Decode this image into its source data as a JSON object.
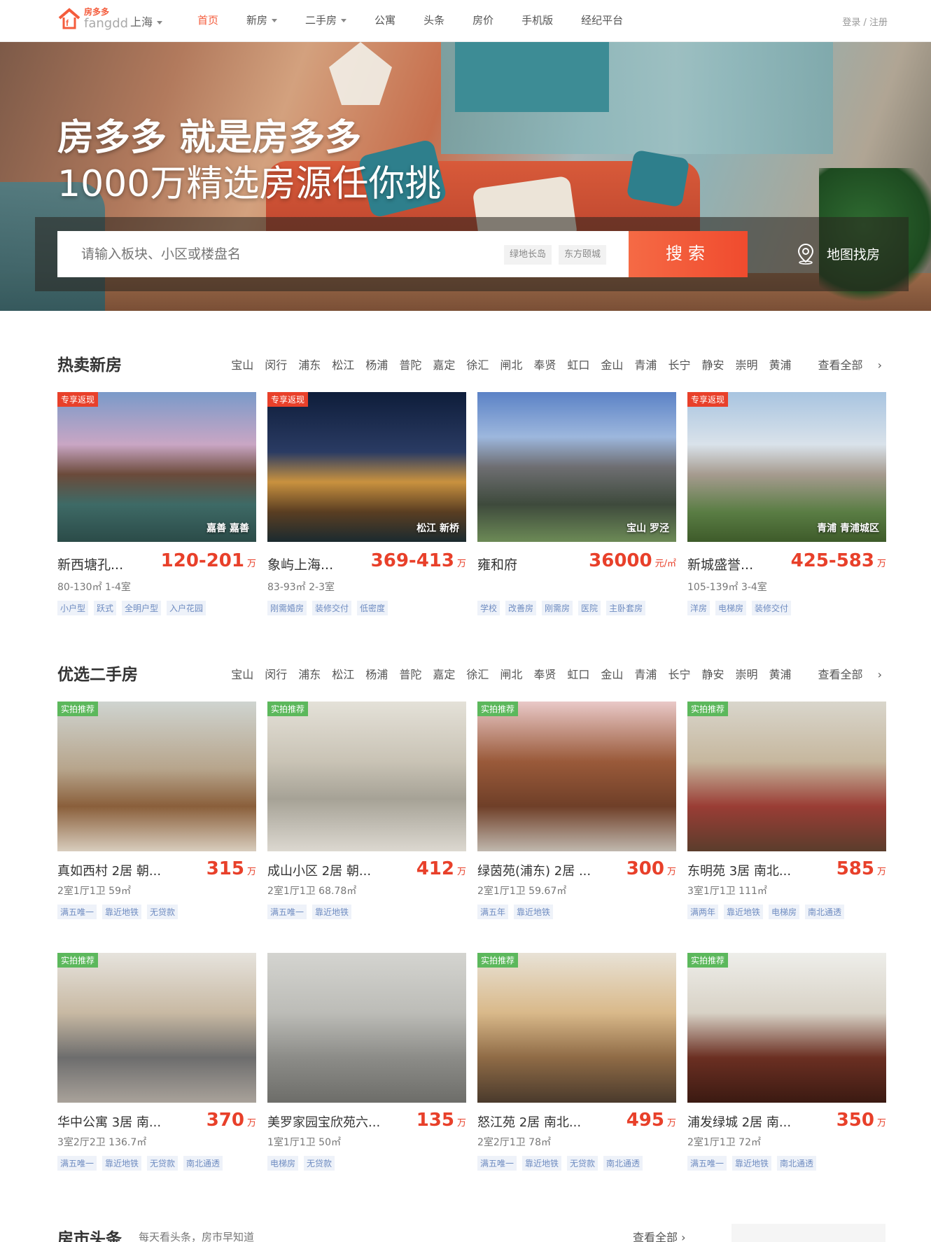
{
  "header": {
    "logo_cn": "房多多",
    "logo_en": "fangdd",
    "city": "上海",
    "nav": [
      {
        "label": "首页",
        "active": true,
        "dropdown": false
      },
      {
        "label": "新房",
        "active": false,
        "dropdown": true
      },
      {
        "label": "二手房",
        "active": false,
        "dropdown": true
      },
      {
        "label": "公寓",
        "active": false,
        "dropdown": false
      },
      {
        "label": "头条",
        "active": false,
        "dropdown": false
      },
      {
        "label": "房价",
        "active": false,
        "dropdown": false
      },
      {
        "label": "手机版",
        "active": false,
        "dropdown": false
      },
      {
        "label": "经纪平台",
        "active": false,
        "dropdown": false
      }
    ],
    "login": "登录 / 注册"
  },
  "hero": {
    "title1": "房多多 就是房多多",
    "title2": "1000万精选房源任你挑",
    "search_placeholder": "请输入板块、小区或楼盘名",
    "chips": [
      "绿地长岛",
      "东方颐城"
    ],
    "search_button": "搜索",
    "map_find": "地图找房"
  },
  "districts": [
    "宝山",
    "闵行",
    "浦东",
    "松江",
    "杨浦",
    "普陀",
    "嘉定",
    "徐汇",
    "闸北",
    "奉贤",
    "虹口",
    "金山",
    "青浦",
    "长宁",
    "静安",
    "崇明",
    "黄浦"
  ],
  "see_all": "查看全部",
  "new_homes": {
    "title": "热卖新房",
    "items": [
      {
        "badge": "专享返现",
        "location": "嘉善 嘉善",
        "name": "新西塘孔...",
        "price": "120-201",
        "unit": "万",
        "spec": "80-130㎡  1-4室",
        "tags": [
          "小户型",
          "跃式",
          "全明户型",
          "入户花园"
        ]
      },
      {
        "badge": "专享返现",
        "location": "松江 新桥",
        "name": "象屿上海...",
        "price": "369-413",
        "unit": "万",
        "spec": "83-93㎡  2-3室",
        "tags": [
          "刚需婚房",
          "装修交付",
          "低密度"
        ]
      },
      {
        "badge": "",
        "location": "宝山 罗泾",
        "name": "雍和府",
        "price": "36000",
        "unit": "元/㎡",
        "spec": "",
        "tags": [
          "学校",
          "改善房",
          "刚需房",
          "医院",
          "主卧套房"
        ]
      },
      {
        "badge": "专享返现",
        "location": "青浦 青浦城区",
        "name": "新城盛誉...",
        "price": "425-583",
        "unit": "万",
        "spec": "105-139㎡  3-4室",
        "tags": [
          "洋房",
          "电梯房",
          "装修交付"
        ]
      }
    ]
  },
  "second_hand": {
    "title": "优选二手房",
    "items": [
      {
        "badge": "实拍推荐",
        "name": "真如西村 2居 朝...",
        "price": "315",
        "unit": "万",
        "spec": "2室1厅1卫  59㎡",
        "tags": [
          "满五唯一",
          "靠近地铁",
          "无贷款"
        ]
      },
      {
        "badge": "实拍推荐",
        "name": "成山小区 2居 朝...",
        "price": "412",
        "unit": "万",
        "spec": "2室1厅1卫  68.78㎡",
        "tags": [
          "满五唯一",
          "靠近地铁"
        ]
      },
      {
        "badge": "实拍推荐",
        "name": "绿茵苑(浦东) 2居 ...",
        "price": "300",
        "unit": "万",
        "spec": "2室1厅1卫  59.67㎡",
        "tags": [
          "满五年",
          "靠近地铁"
        ]
      },
      {
        "badge": "实拍推荐",
        "name": "东明苑 3居 南北...",
        "price": "585",
        "unit": "万",
        "spec": "3室1厅1卫  111㎡",
        "tags": [
          "满两年",
          "靠近地铁",
          "电梯房",
          "南北通透"
        ]
      },
      {
        "badge": "实拍推荐",
        "name": "华中公寓 3居 南...",
        "price": "370",
        "unit": "万",
        "spec": "3室2厅2卫  136.7㎡",
        "tags": [
          "满五唯一",
          "靠近地铁",
          "无贷款",
          "南北通透"
        ]
      },
      {
        "badge": "",
        "name": "美罗家园宝欣苑六...",
        "price": "135",
        "unit": "万",
        "spec": "1室1厅1卫  50㎡",
        "tags": [
          "电梯房",
          "无贷款"
        ]
      },
      {
        "badge": "实拍推荐",
        "name": "怒江苑 2居 南北...",
        "price": "495",
        "unit": "万",
        "spec": "2室2厅1卫  78㎡",
        "tags": [
          "满五唯一",
          "靠近地铁",
          "无贷款",
          "南北通透"
        ]
      },
      {
        "badge": "实拍推荐",
        "name": "浦发绿城 2居 南...",
        "price": "350",
        "unit": "万",
        "spec": "2室1厅1卫  72㎡",
        "tags": [
          "满五唯一",
          "靠近地铁",
          "南北通透"
        ]
      }
    ]
  },
  "news": {
    "title": "房市头条",
    "subtitle": "每天看头条，房市早知道",
    "see_all": "查看全部"
  }
}
